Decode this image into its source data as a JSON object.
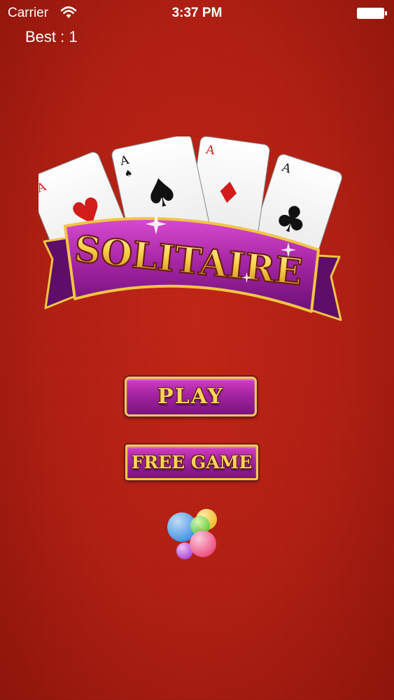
{
  "status_bar": {
    "carrier": "Carrier",
    "time": "3:37 PM"
  },
  "score": {
    "best_label": "Best : 1"
  },
  "logo": {
    "title": "SOLITAIRE",
    "card_rank": "A",
    "card_suits": [
      "heart",
      "spade",
      "diamond",
      "club"
    ]
  },
  "menu": {
    "play_label": "PLAY",
    "free_game_label": "FREE GAME"
  },
  "icons": {
    "game_center": "game-center-icon"
  },
  "colors": {
    "background": "#b01e12",
    "banner_purple": "#a424a0",
    "gold": "#f5c84a"
  }
}
